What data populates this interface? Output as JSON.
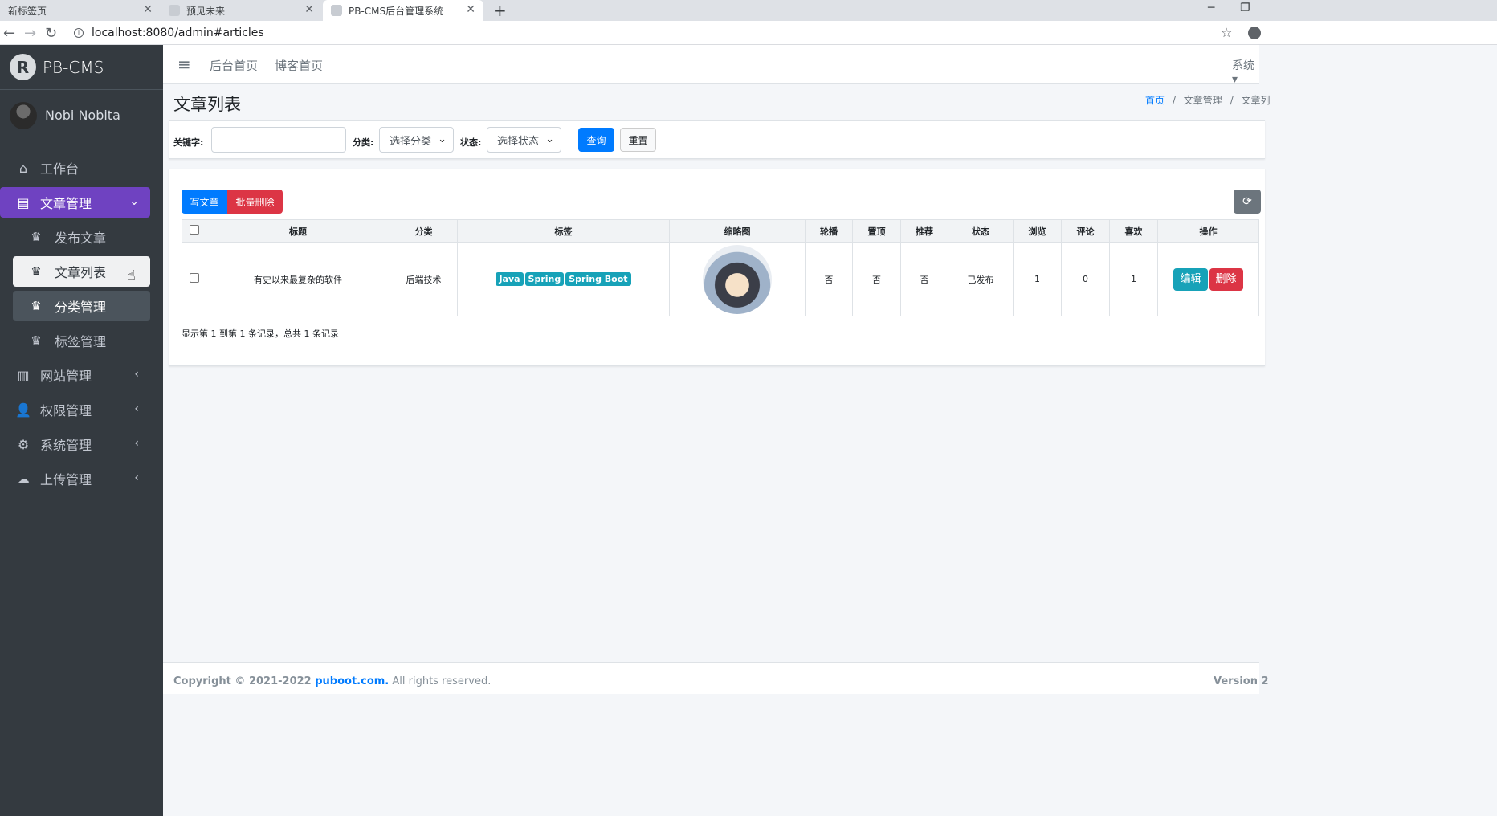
{
  "browser": {
    "tabs": [
      {
        "title": "新标签页"
      },
      {
        "title": "预见未来"
      },
      {
        "title": "PB-CMS后台管理系统"
      }
    ],
    "url": "localhost:8080/admin#articles"
  },
  "sidebar": {
    "brand": "PB-CMS",
    "user": "Nobi Nobita",
    "menu": [
      {
        "label": "工作台",
        "icon": "home-icon"
      },
      {
        "label": "文章管理",
        "icon": "list-icon"
      },
      {
        "label": "网站管理",
        "icon": "columns-icon"
      },
      {
        "label": "权限管理",
        "icon": "user-cog-icon"
      },
      {
        "label": "系统管理",
        "icon": "gear-icon"
      },
      {
        "label": "上传管理",
        "icon": "cloud-upload-icon"
      }
    ],
    "submenu": [
      {
        "label": "发布文章"
      },
      {
        "label": "文章列表"
      },
      {
        "label": "分类管理"
      },
      {
        "label": "标签管理"
      }
    ]
  },
  "navbar": {
    "links": [
      "后台首页",
      "博客首页"
    ],
    "system": "系统"
  },
  "page": {
    "title": "文章列表",
    "breadcrumb": [
      "首页",
      "文章管理",
      "文章列"
    ]
  },
  "filter": {
    "keyword_label": "关键字:",
    "keyword_value": "",
    "category_label": "分类:",
    "category_value": "选择分类",
    "status_label": "状态:",
    "status_value": "选择状态",
    "query_label": "查询",
    "reset_label": "重置"
  },
  "table": {
    "write_label": "写文章",
    "batch_delete_label": "批量删除",
    "headers": [
      "标题",
      "分类",
      "标签",
      "缩略图",
      "轮播",
      "置顶",
      "推荐",
      "状态",
      "浏览",
      "评论",
      "喜欢",
      "操作"
    ],
    "rows": [
      {
        "title": "有史以来最复杂的软件",
        "category": "后端技术",
        "tags": [
          "Java",
          "Spring",
          "Spring Boot"
        ],
        "carousel": "否",
        "top": "否",
        "recommend": "否",
        "status": "已发布",
        "views": "1",
        "comments": "0",
        "likes": "1",
        "edit": "编辑",
        "delete": "删除"
      }
    ],
    "pagination_info": "显示第 1 到第 1 条记录，总共 1 条记录"
  },
  "footer": {
    "copyright_prefix": "Copyright © 2021-2022 ",
    "link": "puboot.com.",
    "suffix": " All rights reserved.",
    "version": "Version 2"
  },
  "colors": {
    "sidebar_bg": "#343a40",
    "active_menu": "#6f42c1",
    "primary": "#007bff",
    "danger": "#dc3545",
    "info": "#17a2b8"
  }
}
